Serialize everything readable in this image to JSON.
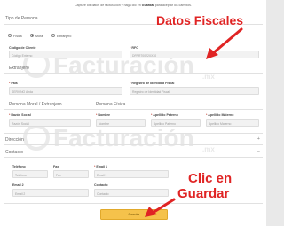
{
  "hint": {
    "before": "Capture los datos de facturación y haga clic en ",
    "keyword": "Guardar",
    "after": " para aceptar los cambios."
  },
  "tipo_persona": {
    "title": "Tipo de Persona",
    "options": [
      {
        "label": "Física",
        "selected": false
      },
      {
        "label": "Moral",
        "selected": true
      },
      {
        "label": "Extranjero",
        "selected": false
      }
    ]
  },
  "datos": {
    "codigo_label": "Código de Cliente",
    "codigo_value": "Código Externo",
    "rfc_label": "RFC",
    "rfc_value": "DFRR70022XX30"
  },
  "extranjero": {
    "title": "Extranjero",
    "pais_label": "País",
    "pais_value": "SERVINO Anda",
    "registro_label": "Registro de Identidad Fiscal",
    "registro_value": "Registro de Identidad Fiscal"
  },
  "moral": {
    "title_moral": "Persona Moral / Extranjero",
    "title_fisica": "Persona Física",
    "razon_label": "Razón Social",
    "razon_value": "Razón Social",
    "nombre_label": "Nombre",
    "nombre_value": "Nombre",
    "paterno_label": "Apellido Paterno",
    "paterno_value": "Apellido Paterno",
    "materno_label": "Apellido Materno",
    "materno_value": "Apellido Materno"
  },
  "direccion": {
    "title": "Dirección",
    "toggle": "+"
  },
  "contacto": {
    "title": "Contacto",
    "toggle": "−",
    "telefono_label": "Teléfono",
    "telefono_value": "Teléfono",
    "fax_label": "Fax",
    "fax_value": "Fax",
    "email1_label": "Email 1",
    "email1_value": "Email 1",
    "email2_label": "Email 2",
    "email2_value": "Email 2",
    "contacto_label": "Contacto",
    "contacto_value": "Contacto"
  },
  "save_label": "Guardar",
  "callouts": {
    "datos_fiscales": "Datos Fiscales",
    "clic_en": "Clic en",
    "guardar": "Guardar"
  },
  "watermark": {
    "word": "Facturación",
    "suffix": ".mx"
  },
  "colors": {
    "callout": "#e02424",
    "save_button": "#f5c24b"
  }
}
